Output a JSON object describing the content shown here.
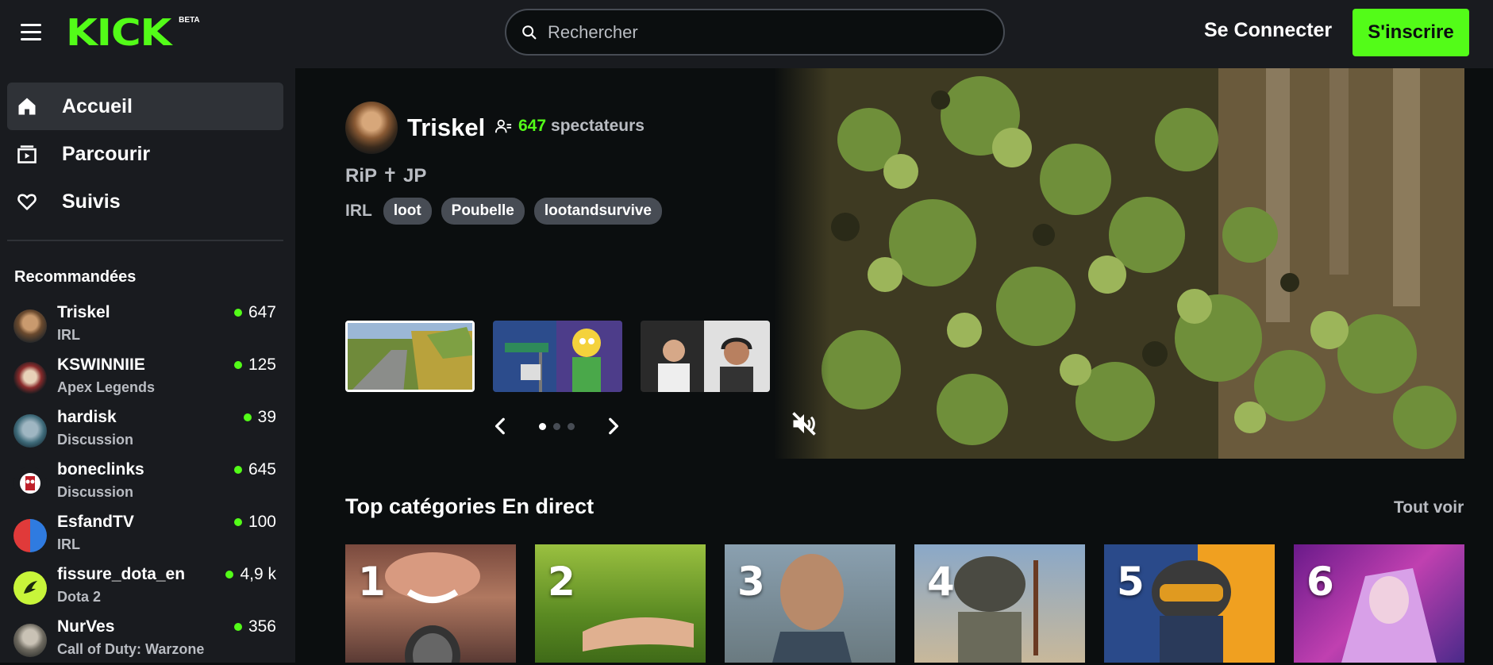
{
  "header": {
    "logo_text": "KICK",
    "beta_label": "BETA",
    "search_placeholder": "Rechercher",
    "login_label": "Se Connecter",
    "signup_label": "S'inscrire",
    "accent_color": "#53fc18"
  },
  "sidebar": {
    "nav": [
      {
        "label": "Accueil",
        "icon": "home-icon",
        "active": true
      },
      {
        "label": "Parcourir",
        "icon": "browse-icon",
        "active": false
      },
      {
        "label": "Suivis",
        "icon": "heart-icon",
        "active": false
      }
    ],
    "recommended_title": "Recommandées",
    "recommended": [
      {
        "name": "Triskel",
        "category": "IRL",
        "viewers": "647"
      },
      {
        "name": "KSWINNIIE",
        "category": "Apex Legends",
        "viewers": "125"
      },
      {
        "name": "hardisk",
        "category": "Discussion",
        "viewers": "39"
      },
      {
        "name": "boneclinks",
        "category": "Discussion",
        "viewers": "645"
      },
      {
        "name": "EsfandTV",
        "category": "IRL",
        "viewers": "100"
      },
      {
        "name": "fissure_dota_en",
        "category": "Dota 2",
        "viewers": "4,9 k"
      },
      {
        "name": "NurVes",
        "category": "Call of Duty: Warzone",
        "viewers": "356"
      }
    ]
  },
  "featured": {
    "streamer": "Triskel",
    "viewer_count": "647",
    "viewer_label": "spectateurs",
    "title": "RiP ✝ JP",
    "category": "IRL",
    "tags": [
      "loot",
      "Poubelle",
      "lootandsurvive"
    ]
  },
  "top_categories": {
    "title": "Top catégories En direct",
    "see_all": "Tout voir",
    "ranks": [
      "1",
      "2",
      "3",
      "4",
      "5",
      "6"
    ]
  }
}
